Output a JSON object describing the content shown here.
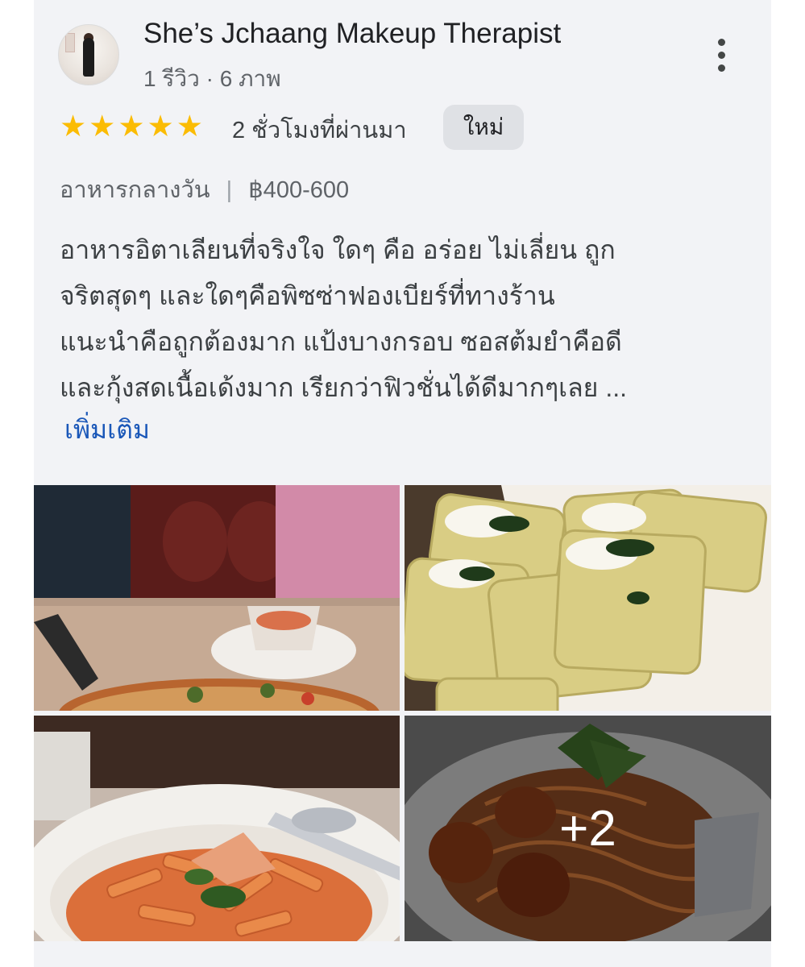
{
  "review": {
    "reviewer_name": "She’s Jchaang Makeup Therapist",
    "reviewer_meta": "1 รีวิว · 6 ภาพ",
    "rating": 5,
    "star_glyph": "★",
    "time_ago": "2 ชั่วโมงที่ผ่านมา",
    "new_badge": "ใหม่",
    "meal_type": "อาหารกลางวัน",
    "separator": "|",
    "price_range": "฿400-600",
    "text_lines": [
      "อาหารอิตาเลียนที่จริงใจ ใดๆ คือ อร่อย ไม่เลี่ยน ถูก",
      "จริตสุดๆ และใดๆคือพิซซ่าฟองเบียร์ที่ทางร้าน",
      "แนะนำคือถูกต้องมาก แป้งบางกรอบ ซอสต้มยำคือดี",
      "และกุ้งสดเนื้อเด้งมาก เรียกว่าฟิวชั่นได้ดีมากๆเลย ..."
    ],
    "more_link": "เพิ่มเติม",
    "more_photos_count": "+2"
  },
  "icons": {
    "avatar": "profile-photo",
    "more": "more-vert-icon",
    "star": "star-icon"
  },
  "colors": {
    "card_bg": "#f2f3f6",
    "star": "#fbbc04",
    "link": "#1a57b8",
    "badge_bg": "#dfe1e5"
  }
}
